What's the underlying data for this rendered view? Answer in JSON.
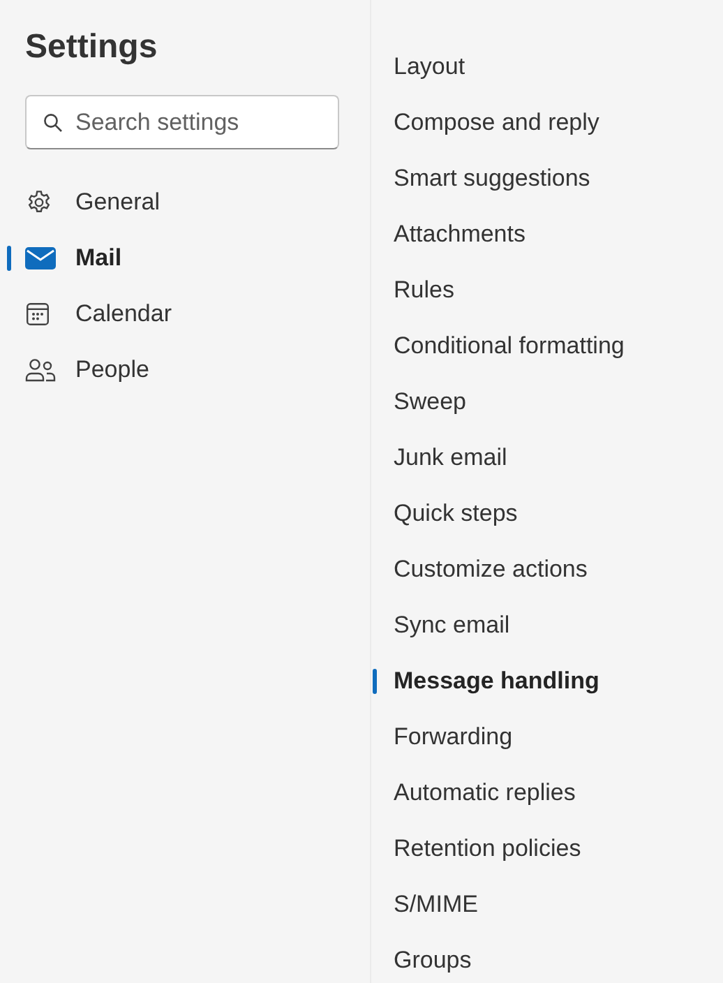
{
  "title": "Settings",
  "search": {
    "placeholder": "Search settings"
  },
  "categories": [
    {
      "label": "General",
      "selected": false
    },
    {
      "label": "Mail",
      "selected": true
    },
    {
      "label": "Calendar",
      "selected": false
    },
    {
      "label": "People",
      "selected": false
    }
  ],
  "sections": [
    {
      "label": "Layout",
      "selected": false
    },
    {
      "label": "Compose and reply",
      "selected": false
    },
    {
      "label": "Smart suggestions",
      "selected": false
    },
    {
      "label": "Attachments",
      "selected": false
    },
    {
      "label": "Rules",
      "selected": false
    },
    {
      "label": "Conditional formatting",
      "selected": false
    },
    {
      "label": "Sweep",
      "selected": false
    },
    {
      "label": "Junk email",
      "selected": false
    },
    {
      "label": "Quick steps",
      "selected": false
    },
    {
      "label": "Customize actions",
      "selected": false
    },
    {
      "label": "Sync email",
      "selected": false
    },
    {
      "label": "Message handling",
      "selected": true
    },
    {
      "label": "Forwarding",
      "selected": false
    },
    {
      "label": "Automatic replies",
      "selected": false
    },
    {
      "label": "Retention policies",
      "selected": false
    },
    {
      "label": "S/MIME",
      "selected": false
    },
    {
      "label": "Groups",
      "selected": false
    }
  ]
}
